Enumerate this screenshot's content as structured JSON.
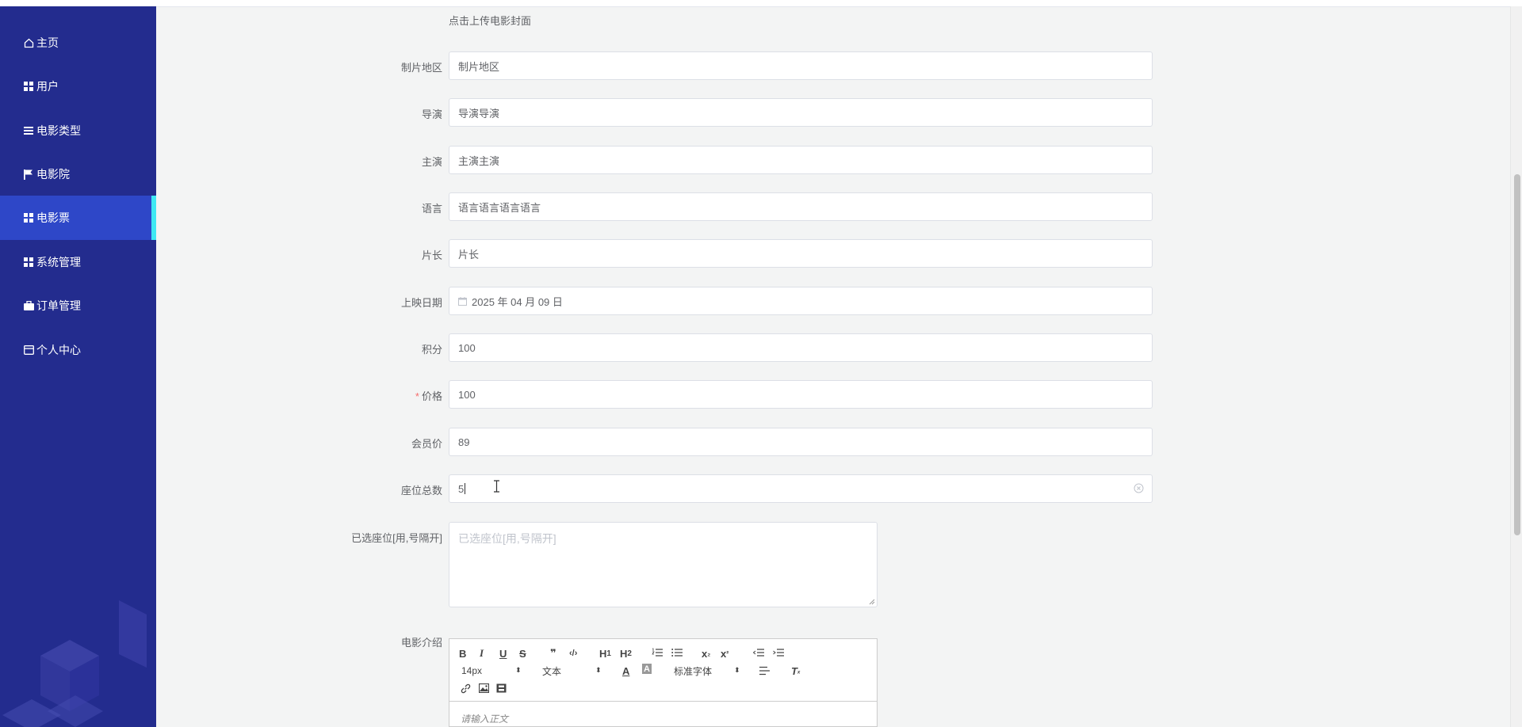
{
  "sidebar": {
    "items": [
      {
        "label": "主页",
        "icon": "home-icon"
      },
      {
        "label": "用户",
        "icon": "grid-icon"
      },
      {
        "label": "电影类型",
        "icon": "list-icon"
      },
      {
        "label": "电影院",
        "icon": "flag-icon"
      },
      {
        "label": "电影票",
        "icon": "grid-icon",
        "active": true
      },
      {
        "label": "系统管理",
        "icon": "grid-icon"
      },
      {
        "label": "订单管理",
        "icon": "briefcase-icon"
      },
      {
        "label": "个人中心",
        "icon": "card-icon"
      }
    ]
  },
  "form": {
    "upload_hint": "点击上传电影封面",
    "fields": [
      {
        "label": "制片地区",
        "value": "制片地区"
      },
      {
        "label": "导演",
        "value": "导演导演"
      },
      {
        "label": "主演",
        "value": "主演主演"
      },
      {
        "label": "语言",
        "value": "语言语言语言语言"
      },
      {
        "label": "片长",
        "value": "片长"
      },
      {
        "label": "上映日期",
        "value": "2025 年 04 月 09 日"
      },
      {
        "label": "积分",
        "value": "100"
      },
      {
        "label": "价格",
        "value": "100",
        "required_mark": "*"
      },
      {
        "label": "会员价",
        "value": "89"
      },
      {
        "label": "座位总数",
        "value": "5"
      }
    ],
    "seats": {
      "label": "已选座位[用,号隔开]",
      "placeholder": "已选座位[用,号隔开]"
    },
    "intro": {
      "label": "电影介绍",
      "font_size": "14px",
      "text_style": "文本",
      "font_family": "标准字体",
      "placeholder": "请输入正文",
      "buttons": {
        "h1": "H",
        "h1sub": "1",
        "h2": "H",
        "h2sub": "2",
        "bold": "B",
        "italic": "I",
        "underline": "U",
        "strike": "S",
        "quote": "❞",
        "code": "‹/›",
        "sub": "x",
        "sub_mark": "₂",
        "sup": "x",
        "sup_mark": "²",
        "clean": "T",
        "clean_mark": "ₓ",
        "font_color": "A",
        "bg_color": "A"
      }
    }
  },
  "colors": {
    "sidebar_bg": "#232c8e",
    "active_bg": "#2e47c8",
    "active_indicator": "#3ee8f3",
    "required": "#f56c6c"
  }
}
